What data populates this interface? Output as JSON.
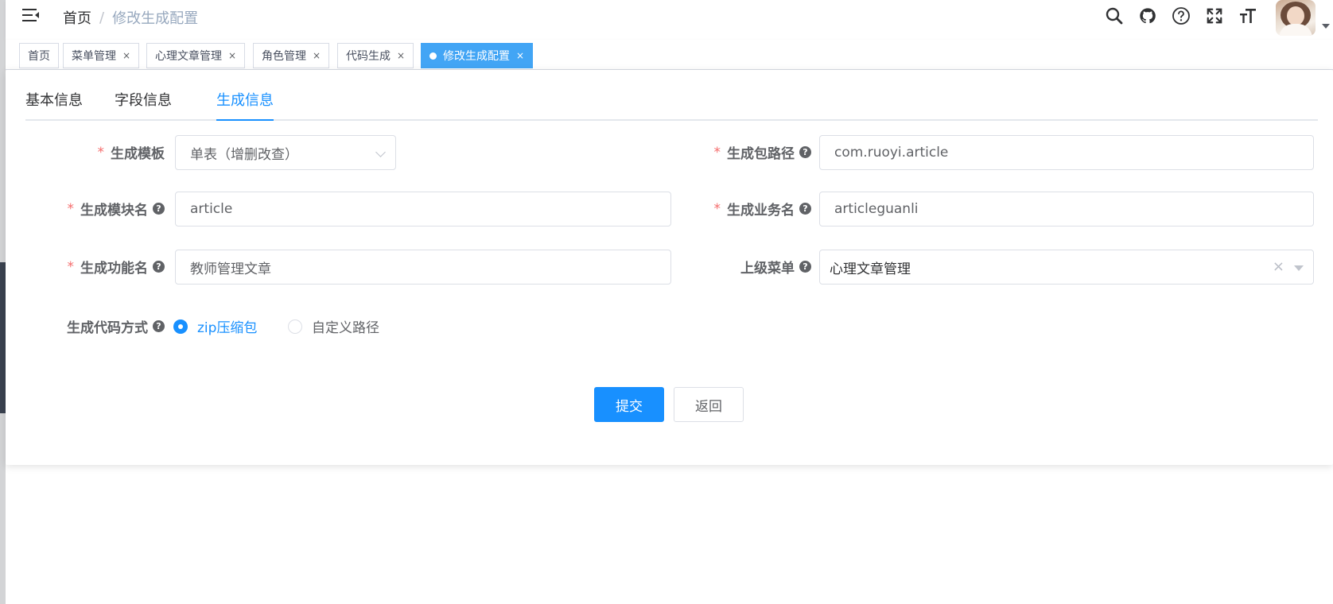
{
  "breadcrumb": {
    "home": "首页",
    "separator": "/",
    "current": "修改生成配置"
  },
  "navbar_icons": [
    "search-icon",
    "github-icon",
    "question-icon",
    "fullscreen-icon",
    "font-size-icon"
  ],
  "tags": [
    {
      "label": "首页",
      "closable": false
    },
    {
      "label": "菜单管理",
      "closable": true
    },
    {
      "label": "心理文章管理",
      "closable": true
    },
    {
      "label": "角色管理",
      "closable": true
    },
    {
      "label": "代码生成",
      "closable": true
    },
    {
      "label": "修改生成配置",
      "closable": true,
      "active": true
    }
  ],
  "close_glyph": "×",
  "tabs": [
    "基本信息",
    "字段信息",
    "生成信息"
  ],
  "active_tab": "生成信息",
  "form": {
    "tpl_category": {
      "label": "生成模板",
      "value": "单表（增删改查）"
    },
    "package_name": {
      "label": "生成包路径",
      "value": "com.ruoyi.article"
    },
    "module_name": {
      "label": "生成模块名",
      "value": "article"
    },
    "business_name": {
      "label": "生成业务名",
      "value": "articleguanli"
    },
    "function_name": {
      "label": "生成功能名",
      "value": "教师管理文章"
    },
    "parent_menu": {
      "label": "上级菜单",
      "value": "心理文章管理"
    },
    "gen_type": {
      "label": "生成代码方式",
      "options": [
        "zip压缩包",
        "自定义路径"
      ],
      "selected": "zip压缩包"
    }
  },
  "required_mark": "*",
  "help_mark": "?",
  "buttons": {
    "submit": "提交",
    "back": "返回"
  },
  "colors": {
    "primary": "#1890ff",
    "active_tag": "#42a5f5",
    "required": "#f56c6c"
  }
}
